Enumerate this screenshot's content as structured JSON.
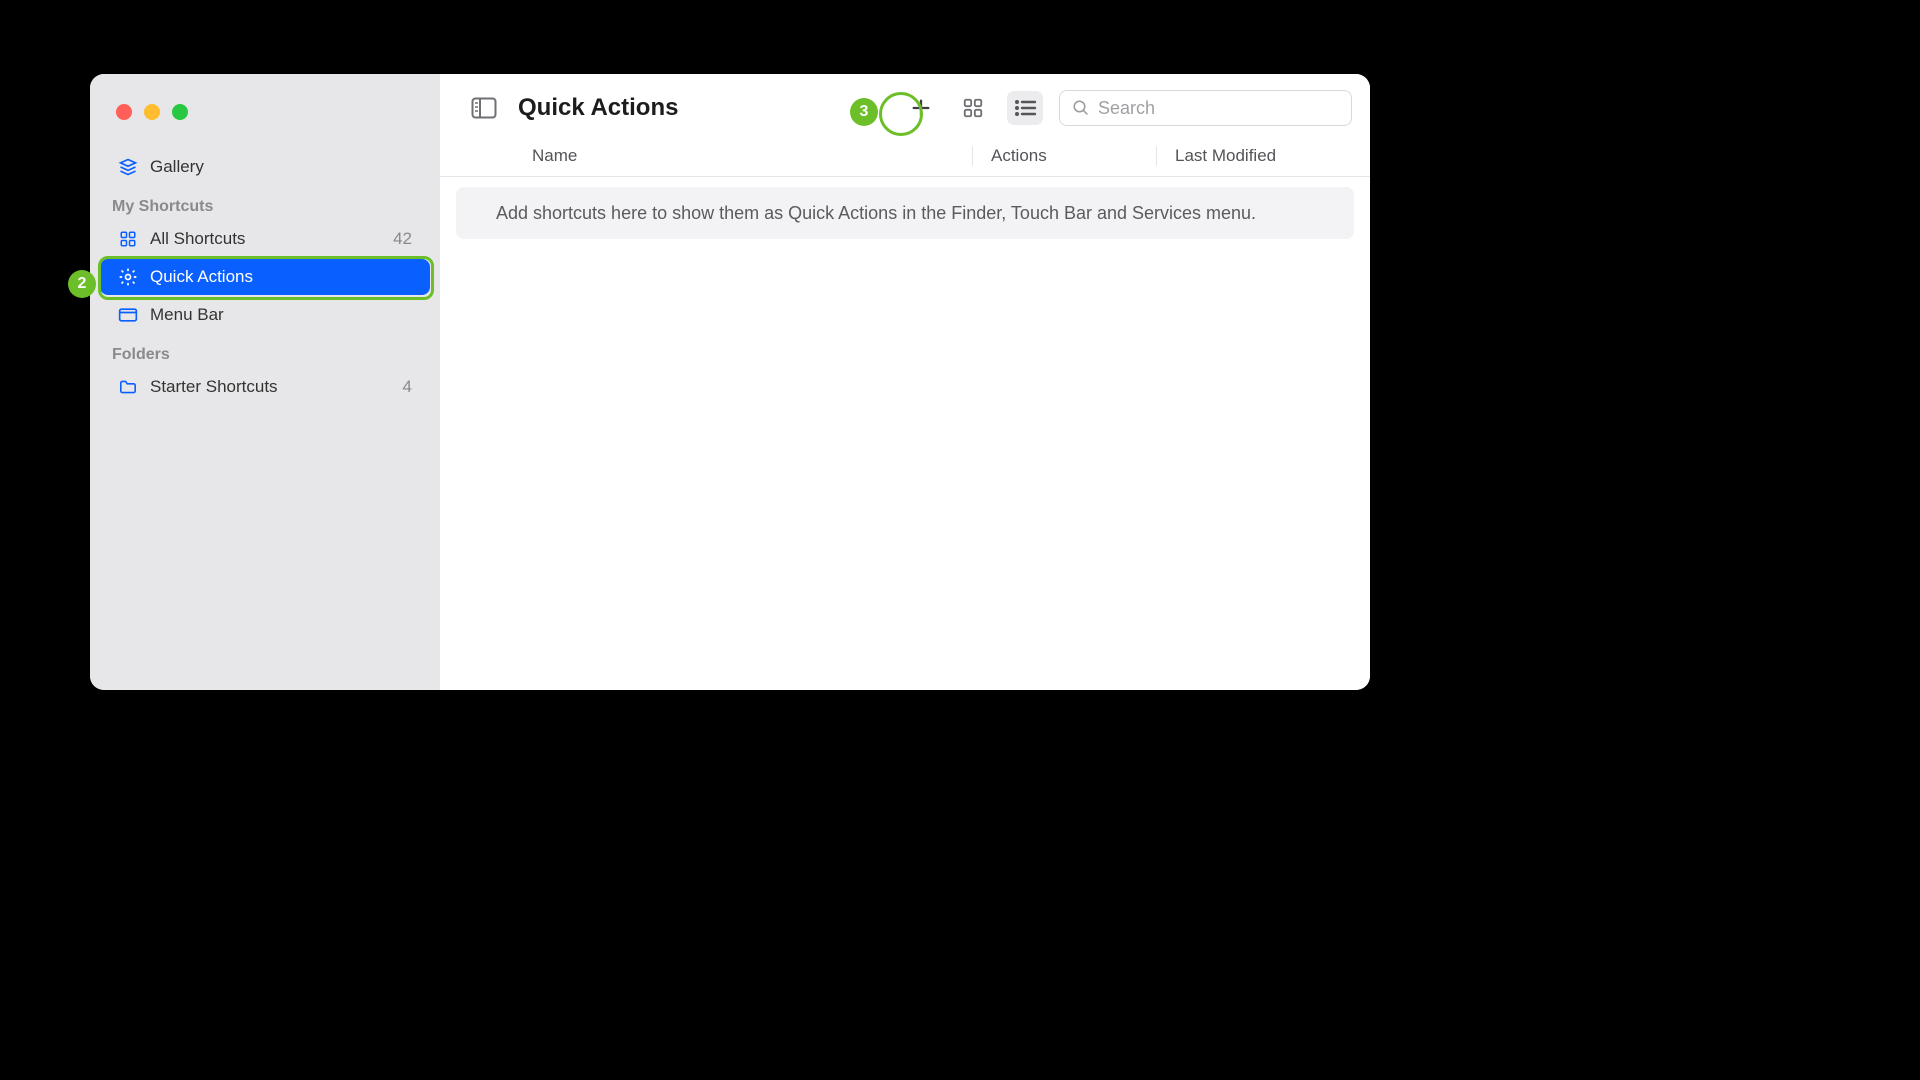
{
  "window": {
    "title": "Quick Actions",
    "search_placeholder": "Search"
  },
  "sidebar": {
    "gallery_label": "Gallery",
    "sections": {
      "my_shortcuts_header": "My Shortcuts",
      "folders_header": "Folders"
    },
    "items": {
      "all_shortcuts": {
        "label": "All Shortcuts",
        "count": "42"
      },
      "quick_actions": {
        "label": "Quick Actions"
      },
      "menu_bar": {
        "label": "Menu Bar"
      },
      "starter_shortcuts": {
        "label": "Starter Shortcuts",
        "count": "4"
      }
    }
  },
  "columns": {
    "name": "Name",
    "actions": "Actions",
    "modified": "Last Modified"
  },
  "empty_message": "Add shortcuts here to show them as Quick Actions in the Finder, Touch Bar and Services menu.",
  "annotations": {
    "step2": "2",
    "step3": "3"
  },
  "colors": {
    "accent": "#0a60ff",
    "callout": "#6cbf28"
  }
}
